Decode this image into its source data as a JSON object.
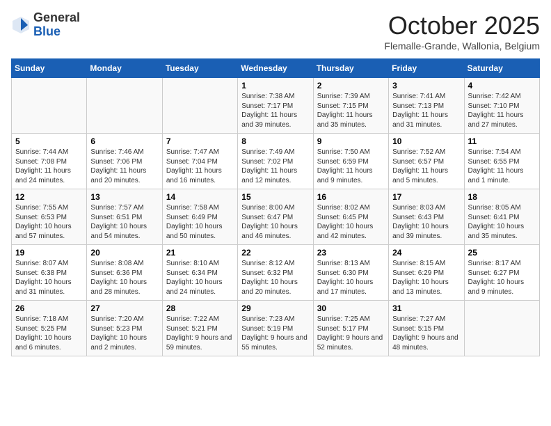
{
  "header": {
    "logo_general": "General",
    "logo_blue": "Blue",
    "month_title": "October 2025",
    "subtitle": "Flemalle-Grande, Wallonia, Belgium"
  },
  "weekdays": [
    "Sunday",
    "Monday",
    "Tuesday",
    "Wednesday",
    "Thursday",
    "Friday",
    "Saturday"
  ],
  "weeks": [
    [
      {
        "day": "",
        "info": ""
      },
      {
        "day": "",
        "info": ""
      },
      {
        "day": "",
        "info": ""
      },
      {
        "day": "1",
        "info": "Sunrise: 7:38 AM\nSunset: 7:17 PM\nDaylight: 11 hours and 39 minutes."
      },
      {
        "day": "2",
        "info": "Sunrise: 7:39 AM\nSunset: 7:15 PM\nDaylight: 11 hours and 35 minutes."
      },
      {
        "day": "3",
        "info": "Sunrise: 7:41 AM\nSunset: 7:13 PM\nDaylight: 11 hours and 31 minutes."
      },
      {
        "day": "4",
        "info": "Sunrise: 7:42 AM\nSunset: 7:10 PM\nDaylight: 11 hours and 27 minutes."
      }
    ],
    [
      {
        "day": "5",
        "info": "Sunrise: 7:44 AM\nSunset: 7:08 PM\nDaylight: 11 hours and 24 minutes."
      },
      {
        "day": "6",
        "info": "Sunrise: 7:46 AM\nSunset: 7:06 PM\nDaylight: 11 hours and 20 minutes."
      },
      {
        "day": "7",
        "info": "Sunrise: 7:47 AM\nSunset: 7:04 PM\nDaylight: 11 hours and 16 minutes."
      },
      {
        "day": "8",
        "info": "Sunrise: 7:49 AM\nSunset: 7:02 PM\nDaylight: 11 hours and 12 minutes."
      },
      {
        "day": "9",
        "info": "Sunrise: 7:50 AM\nSunset: 6:59 PM\nDaylight: 11 hours and 9 minutes."
      },
      {
        "day": "10",
        "info": "Sunrise: 7:52 AM\nSunset: 6:57 PM\nDaylight: 11 hours and 5 minutes."
      },
      {
        "day": "11",
        "info": "Sunrise: 7:54 AM\nSunset: 6:55 PM\nDaylight: 11 hours and 1 minute."
      }
    ],
    [
      {
        "day": "12",
        "info": "Sunrise: 7:55 AM\nSunset: 6:53 PM\nDaylight: 10 hours and 57 minutes."
      },
      {
        "day": "13",
        "info": "Sunrise: 7:57 AM\nSunset: 6:51 PM\nDaylight: 10 hours and 54 minutes."
      },
      {
        "day": "14",
        "info": "Sunrise: 7:58 AM\nSunset: 6:49 PM\nDaylight: 10 hours and 50 minutes."
      },
      {
        "day": "15",
        "info": "Sunrise: 8:00 AM\nSunset: 6:47 PM\nDaylight: 10 hours and 46 minutes."
      },
      {
        "day": "16",
        "info": "Sunrise: 8:02 AM\nSunset: 6:45 PM\nDaylight: 10 hours and 42 minutes."
      },
      {
        "day": "17",
        "info": "Sunrise: 8:03 AM\nSunset: 6:43 PM\nDaylight: 10 hours and 39 minutes."
      },
      {
        "day": "18",
        "info": "Sunrise: 8:05 AM\nSunset: 6:41 PM\nDaylight: 10 hours and 35 minutes."
      }
    ],
    [
      {
        "day": "19",
        "info": "Sunrise: 8:07 AM\nSunset: 6:38 PM\nDaylight: 10 hours and 31 minutes."
      },
      {
        "day": "20",
        "info": "Sunrise: 8:08 AM\nSunset: 6:36 PM\nDaylight: 10 hours and 28 minutes."
      },
      {
        "day": "21",
        "info": "Sunrise: 8:10 AM\nSunset: 6:34 PM\nDaylight: 10 hours and 24 minutes."
      },
      {
        "day": "22",
        "info": "Sunrise: 8:12 AM\nSunset: 6:32 PM\nDaylight: 10 hours and 20 minutes."
      },
      {
        "day": "23",
        "info": "Sunrise: 8:13 AM\nSunset: 6:30 PM\nDaylight: 10 hours and 17 minutes."
      },
      {
        "day": "24",
        "info": "Sunrise: 8:15 AM\nSunset: 6:29 PM\nDaylight: 10 hours and 13 minutes."
      },
      {
        "day": "25",
        "info": "Sunrise: 8:17 AM\nSunset: 6:27 PM\nDaylight: 10 hours and 9 minutes."
      }
    ],
    [
      {
        "day": "26",
        "info": "Sunrise: 7:18 AM\nSunset: 5:25 PM\nDaylight: 10 hours and 6 minutes."
      },
      {
        "day": "27",
        "info": "Sunrise: 7:20 AM\nSunset: 5:23 PM\nDaylight: 10 hours and 2 minutes."
      },
      {
        "day": "28",
        "info": "Sunrise: 7:22 AM\nSunset: 5:21 PM\nDaylight: 9 hours and 59 minutes."
      },
      {
        "day": "29",
        "info": "Sunrise: 7:23 AM\nSunset: 5:19 PM\nDaylight: 9 hours and 55 minutes."
      },
      {
        "day": "30",
        "info": "Sunrise: 7:25 AM\nSunset: 5:17 PM\nDaylight: 9 hours and 52 minutes."
      },
      {
        "day": "31",
        "info": "Sunrise: 7:27 AM\nSunset: 5:15 PM\nDaylight: 9 hours and 48 minutes."
      },
      {
        "day": "",
        "info": ""
      }
    ]
  ]
}
